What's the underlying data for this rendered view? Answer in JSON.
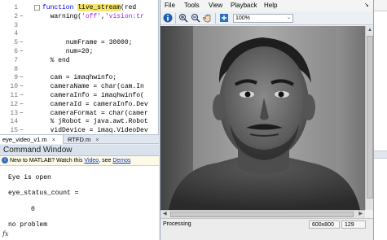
{
  "editor": {
    "lines": [
      {
        "num": "1",
        "bp": "",
        "fold": true,
        "parts": [
          {
            "t": "function ",
            "c": "kw"
          },
          {
            "t": "live_stream",
            "c": "hl"
          },
          {
            "t": "(red",
            "c": ""
          }
        ]
      },
      {
        "num": "2",
        "bp": "−",
        "fold": false,
        "parts": [
          {
            "t": "  warning(",
            "c": ""
          },
          {
            "t": "'off'",
            "c": "str"
          },
          {
            "t": ",",
            "c": ""
          },
          {
            "t": "'vision:tr",
            "c": "str"
          }
        ]
      },
      {
        "num": "3",
        "bp": "",
        "fold": false,
        "parts": []
      },
      {
        "num": "4",
        "bp": "",
        "fold": false,
        "parts": []
      },
      {
        "num": "5",
        "bp": "−",
        "fold": false,
        "parts": [
          {
            "t": "      numFrame = 30000;",
            "c": ""
          }
        ]
      },
      {
        "num": "6",
        "bp": "−",
        "fold": false,
        "parts": [
          {
            "t": "      num=20;",
            "c": ""
          }
        ]
      },
      {
        "num": "7",
        "bp": "",
        "fold": false,
        "parts": [
          {
            "t": "  % end",
            "c": "comment"
          }
        ]
      },
      {
        "num": "8",
        "bp": "",
        "fold": false,
        "parts": []
      },
      {
        "num": "9",
        "bp": "−",
        "fold": false,
        "parts": [
          {
            "t": "  cam = imaqhwinfo;",
            "c": ""
          }
        ]
      },
      {
        "num": "10",
        "bp": "−",
        "fold": false,
        "parts": [
          {
            "t": "  cameraName = char(cam.In",
            "c": ""
          }
        ]
      },
      {
        "num": "11",
        "bp": "−",
        "fold": false,
        "parts": [
          {
            "t": "  cameraInfo = imaqhwinfo(",
            "c": ""
          }
        ]
      },
      {
        "num": "12",
        "bp": "−",
        "fold": false,
        "parts": [
          {
            "t": "  cameraId = cameraInfo.Dev",
            "c": ""
          }
        ]
      },
      {
        "num": "13",
        "bp": "−",
        "fold": false,
        "parts": [
          {
            "t": "  cameraFormat = char(camer",
            "c": ""
          }
        ]
      },
      {
        "num": "14",
        "bp": "",
        "fold": false,
        "parts": [
          {
            "t": "  % jRobot = java.awt.Robot",
            "c": "comment"
          }
        ]
      },
      {
        "num": "15",
        "bp": "−",
        "fold": false,
        "parts": [
          {
            "t": "  vidDevice = imaq.VideoDev",
            "c": ""
          }
        ]
      }
    ]
  },
  "tabs": [
    {
      "label": "eye_video_v1.m",
      "close": "×",
      "active": true
    },
    {
      "label": "RTFD.m",
      "close": "×",
      "active": false
    }
  ],
  "command_window": {
    "title": "Command Window",
    "notice_prefix": "New to MATLAB? Watch this ",
    "notice_link1": "Video",
    "notice_mid": ", see ",
    "notice_link2": "Demos",
    "lines": [
      "Eye is open",
      "eye_status_count =",
      "0",
      "no problem"
    ],
    "prompt": "fx"
  },
  "player": {
    "menu": [
      "File",
      "Tools",
      "View",
      "Playback",
      "Help"
    ],
    "zoom": "100%",
    "status": {
      "left": "Processing",
      "size": "600x800",
      "frame": "129"
    }
  },
  "colors": {
    "matlab_keyword": "#0000ff",
    "matlab_comment": "#228b22",
    "matlab_string": "#a020f0",
    "highlight": "#f5e66b"
  }
}
